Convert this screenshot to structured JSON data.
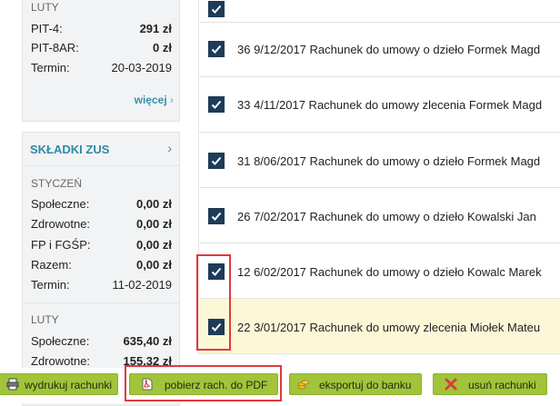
{
  "tax": {
    "month": "LUTY",
    "rows": [
      {
        "label": "PIT-4:",
        "value": "291 zł"
      },
      {
        "label": "PIT-8AR:",
        "value": "0 zł"
      },
      {
        "label": "Termin:",
        "value": "20-03-2019"
      }
    ],
    "more_label": "więcej",
    "more_chevron": "›"
  },
  "zus": {
    "title": "SKŁADKI ZUS",
    "chevron": "›",
    "months": [
      {
        "month": "STYCZEŃ",
        "rows": [
          {
            "label": "Społeczne:",
            "value": "0,00 zł"
          },
          {
            "label": "Zdrowotne:",
            "value": "0,00 zł"
          },
          {
            "label": "FP i FGŚP:",
            "value": "0,00 zł"
          },
          {
            "label": "Razem:",
            "value": "0,00 zł"
          },
          {
            "label": "Termin:",
            "value": "11-02-2019"
          }
        ]
      },
      {
        "month": "LUTY",
        "rows": [
          {
            "label": "Społeczne:",
            "value": "635,40 zł"
          },
          {
            "label": "Zdrowotne:",
            "value": "155,32 zł"
          }
        ]
      }
    ]
  },
  "bills": [
    {
      "text": "",
      "checked": true
    },
    {
      "text": "36  9/12/2017  Rachunek do umowy o dzieło  Formek Magd",
      "checked": true
    },
    {
      "text": "33  4/11/2017  Rachunek do umowy zlecenia  Formek Magd",
      "checked": true
    },
    {
      "text": "31  8/06/2017  Rachunek do umowy o dzieło  Formek Magd",
      "checked": true
    },
    {
      "text": "26  7/02/2017  Rachunek do umowy o dzieło  Kowalski Jan",
      "checked": true
    },
    {
      "text": "12  6/02/2017  Rachunek do umowy o dzieło  Kowalc Marek",
      "checked": true
    },
    {
      "text": "22  3/01/2017  Rachunek do umowy zlecenia  Miołek Mateu",
      "checked": true
    }
  ],
  "toolbar": {
    "print": "wydrukuj rachunki",
    "pdf": "pobierz rach. do PDF",
    "bank": "eksportuj do banku",
    "delete": "usuń rachunki"
  },
  "colors": {
    "accent": "#2e8aa6",
    "button": "#a1c43a",
    "highlight": "#fcf8d7",
    "selection": "#e0393e"
  }
}
